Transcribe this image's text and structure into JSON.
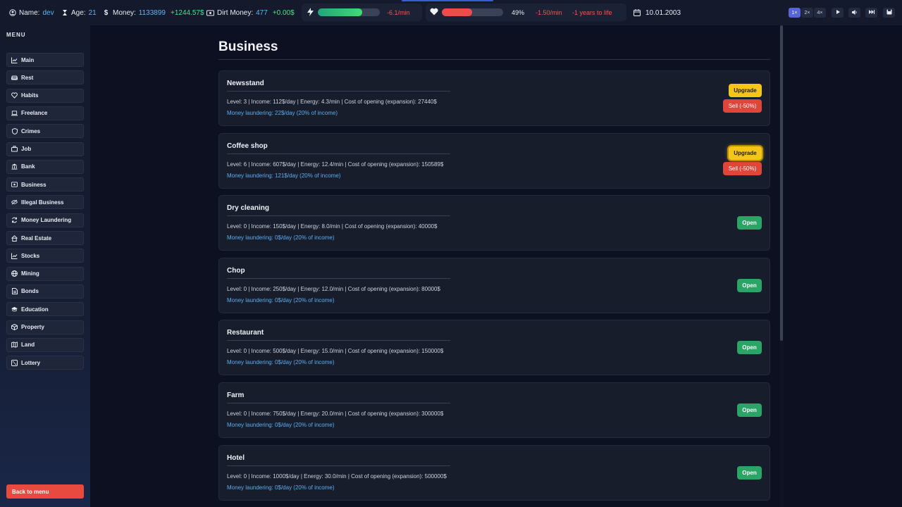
{
  "topbar": {
    "name_label": "Name:",
    "name_value": "dev",
    "age_label": "Age:",
    "age_value": "21",
    "money_label": "Money:",
    "money_value": "1133899",
    "money_delta": "+1244.57$",
    "dirt_label": "Dirt Money:",
    "dirt_value": "477",
    "dirt_delta": "+0.00$",
    "energy_rate": "-6.1/min",
    "energy_fill": 0.72,
    "health_percent": "49%",
    "health_fill": 0.49,
    "health_rate": "-1.50/min",
    "life_text": "-1 years to life",
    "date": "10.01.2003",
    "speeds": [
      "1×",
      "2×",
      "4×"
    ],
    "active_speed": 0
  },
  "sidebar": {
    "title": "MENU",
    "items": [
      {
        "label": "Main",
        "icon": "chart-line-icon"
      },
      {
        "label": "Rest",
        "icon": "couch-icon"
      },
      {
        "label": "Habits",
        "icon": "heart-icon"
      },
      {
        "label": "Freelance",
        "icon": "laptop-icon"
      },
      {
        "label": "Crimes",
        "icon": "shield-icon"
      },
      {
        "label": "Job",
        "icon": "briefcase-icon"
      },
      {
        "label": "Bank",
        "icon": "bank-icon"
      },
      {
        "label": "Business",
        "icon": "store-icon"
      },
      {
        "label": "Illegal Business",
        "icon": "eye-slash-icon"
      },
      {
        "label": "Money Laundering",
        "icon": "refresh-icon"
      },
      {
        "label": "Real Estate",
        "icon": "house-icon"
      },
      {
        "label": "Stocks",
        "icon": "chart-line-icon"
      },
      {
        "label": "Mining",
        "icon": "globe-icon"
      },
      {
        "label": "Bonds",
        "icon": "document-icon"
      },
      {
        "label": "Education",
        "icon": "graduation-cap-icon"
      },
      {
        "label": "Property",
        "icon": "box-icon"
      },
      {
        "label": "Land",
        "icon": "map-icon"
      },
      {
        "label": "Lottery",
        "icon": "dice-icon"
      }
    ],
    "back_label": "Back to menu"
  },
  "main": {
    "title": "Business",
    "upgrade_label": "Upgrade",
    "sell_label": "Sell (-50%)",
    "open_label": "Open",
    "businesses": [
      {
        "name": "Newsstand",
        "info": "Level: 3 | Income: 112$/day | Energy: 4.3/min | Cost of opening (expansion): 27440$",
        "laundering": "Money laundering: 22$/day (20% of income)",
        "owned": true
      },
      {
        "name": "Coffee shop",
        "info": "Level: 6 | Income: 607$/day | Energy: 12.4/min | Cost of opening (expansion): 150589$",
        "laundering": "Money laundering: 121$/day (20% of income)",
        "owned": true
      },
      {
        "name": "Dry cleaning",
        "info": "Level: 0 | Income: 150$/day | Energy: 8.0/min | Cost of opening (expansion): 40000$",
        "laundering": "Money laundering: 0$/day (20% of income)",
        "owned": false
      },
      {
        "name": "Chop",
        "info": "Level: 0 | Income: 250$/day | Energy: 12.0/min | Cost of opening (expansion): 80000$",
        "laundering": "Money laundering: 0$/day (20% of income)",
        "owned": false
      },
      {
        "name": "Restaurant",
        "info": "Level: 0 | Income: 500$/day | Energy: 15.0/min | Cost of opening (expansion): 150000$",
        "laundering": "Money laundering: 0$/day (20% of income)",
        "owned": false
      },
      {
        "name": "Farm",
        "info": "Level: 0 | Income: 750$/day | Energy: 20.0/min | Cost of opening (expansion): 300000$",
        "laundering": "Money laundering: 0$/day (20% of income)",
        "owned": false
      },
      {
        "name": "Hotel",
        "info": "Level: 0 | Income: 1000$/day | Energy: 30.0/min | Cost of opening (expansion): 500000$",
        "laundering": "Money laundering: 0$/day (20% of income)",
        "owned": false
      }
    ]
  }
}
